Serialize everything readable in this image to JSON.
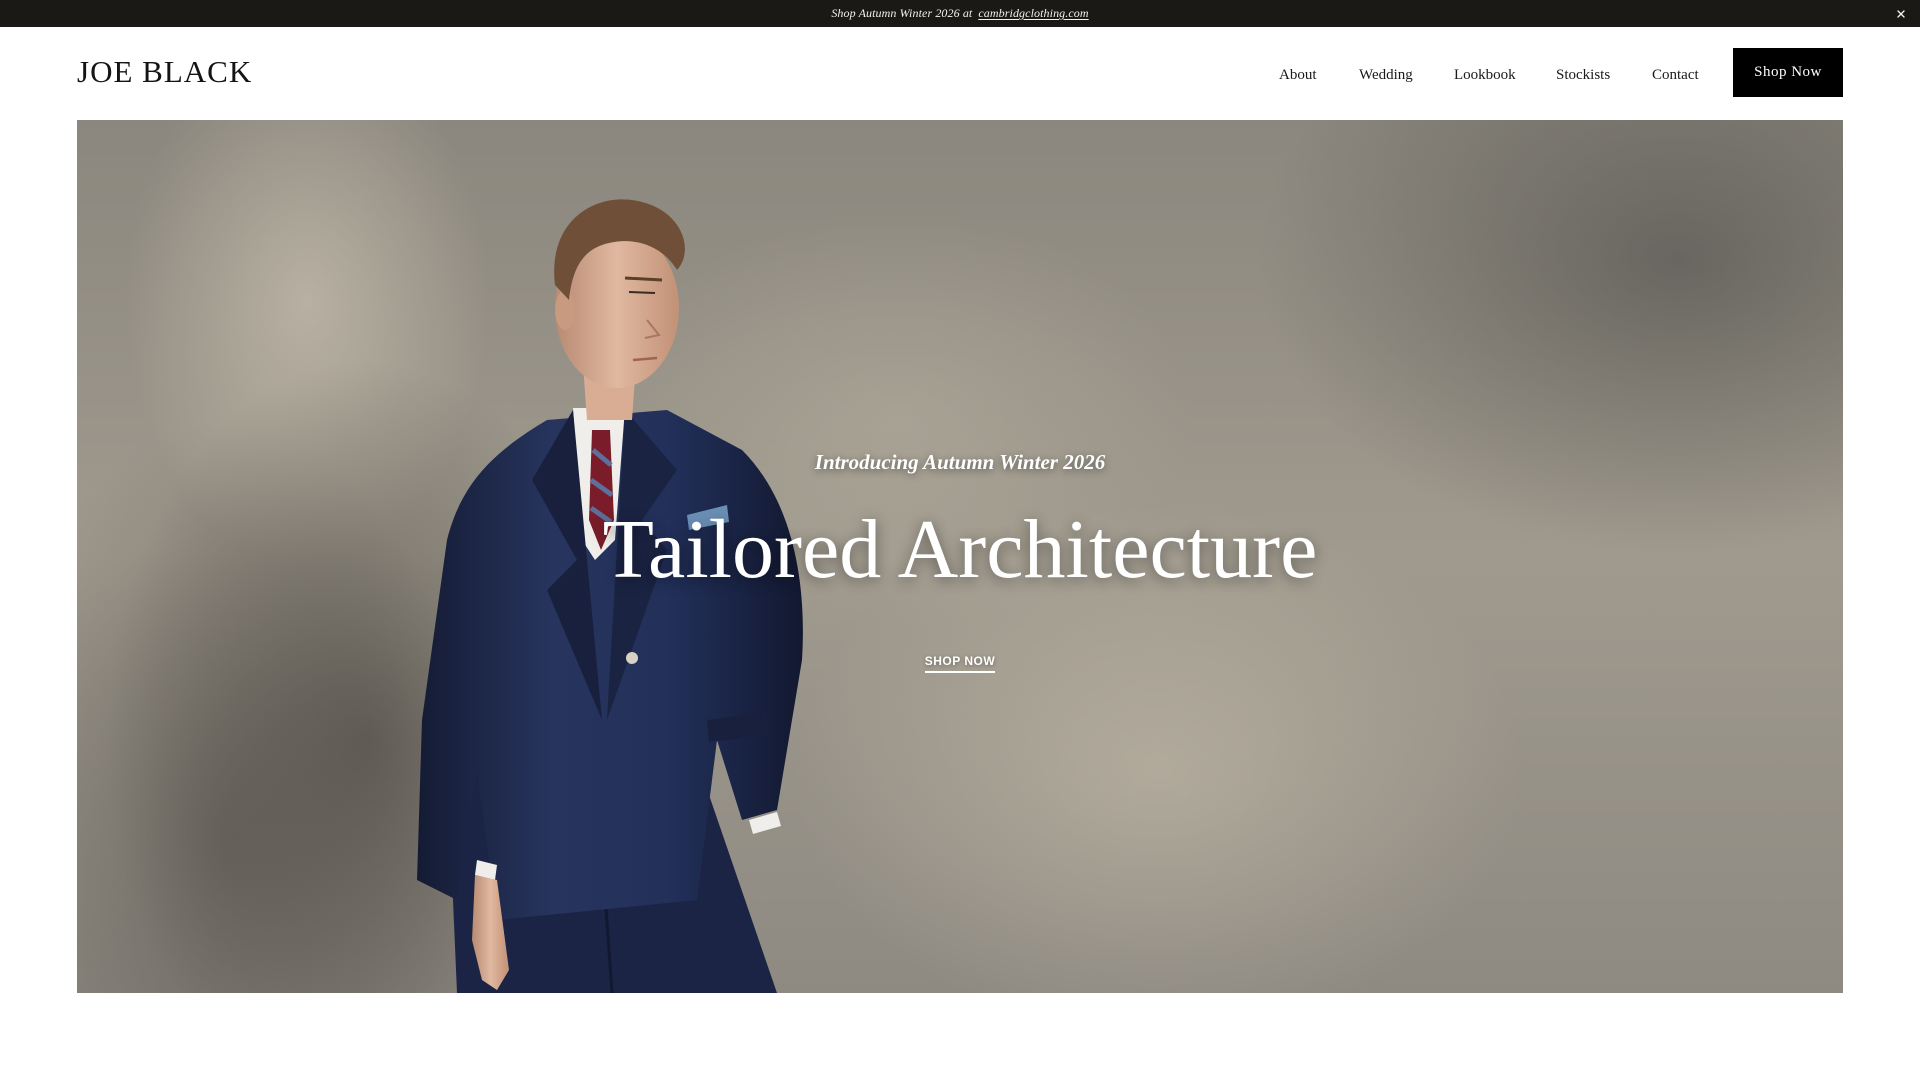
{
  "announcement": {
    "text": "Shop Autumn Winter 2026 at",
    "link": "cambridgclothing.com",
    "close_icon": "close-icon"
  },
  "header": {
    "logo": "JOE BLACK",
    "nav": [
      {
        "label": "About"
      },
      {
        "label": "Wedding"
      },
      {
        "label": "Lookbook"
      },
      {
        "label": "Stockists"
      },
      {
        "label": "Contact"
      }
    ],
    "cta": "Shop Now"
  },
  "hero": {
    "subtitle": "Introducing Autumn Winter 2026",
    "title": "Tailored Architecture",
    "cta": "SHOP NOW"
  },
  "colors": {
    "announcement_bg": "#1b1916",
    "button_bg": "#000000",
    "text": "#1a1a1a",
    "suit": "#1f2a4d"
  }
}
